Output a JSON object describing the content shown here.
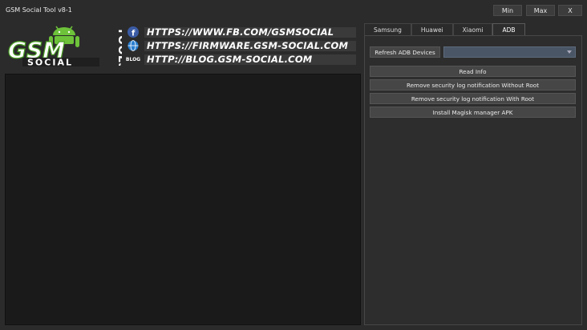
{
  "app": {
    "title": "GSM Social Tool v8-1"
  },
  "window_buttons": {
    "min": "Min",
    "max": "Max",
    "close": "X"
  },
  "banner": {
    "tools_label": "TOOLS",
    "urls": [
      {
        "icon": "facebook-icon",
        "text": "HTTPS://WWW.FB.COM/GSMSOCIAL"
      },
      {
        "icon": "globe-icon",
        "text": "HTTPS://FIRMWARE.GSM-SOCIAL.COM"
      },
      {
        "icon": "blog-icon",
        "label": "BLOG",
        "text": "HTTP://BLOG.GSM-SOCIAL.COM"
      }
    ]
  },
  "tabs": [
    {
      "label": "Samsung"
    },
    {
      "label": "Huawei"
    },
    {
      "label": "Xiaomi"
    },
    {
      "label": "ADB",
      "active": true
    }
  ],
  "adb_panel": {
    "refresh_label": "Refresh ADB Devices",
    "device_select_value": "",
    "actions": [
      {
        "label": "Read Info"
      },
      {
        "label": "Remove security log notification Without Root"
      },
      {
        "label": "Remove security log notification With Root"
      },
      {
        "label": "Install Magisk manager APK"
      }
    ]
  },
  "colors": {
    "background": "#2b2b2b",
    "log_panel": "#1a1a1a",
    "accent_green": "#5db82f",
    "combo": "#4a5666"
  }
}
